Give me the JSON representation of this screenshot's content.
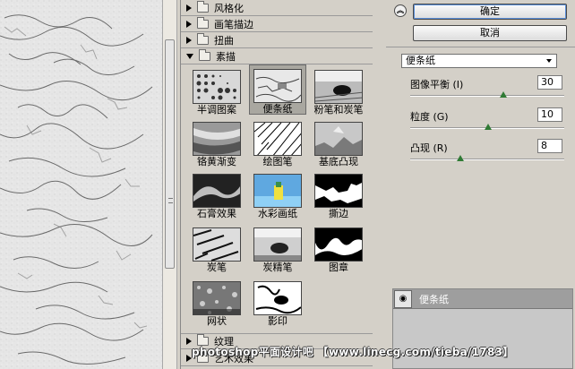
{
  "gallery": {
    "categories_top": [
      {
        "label": "风格化"
      },
      {
        "label": "画笔描边"
      },
      {
        "label": "扭曲"
      }
    ],
    "open_category": {
      "label": "素描"
    },
    "categories_bottom": [
      {
        "label": "纹理"
      },
      {
        "label": "艺术效果"
      }
    ],
    "filters": [
      {
        "label": "半调图案"
      },
      {
        "label": "便条纸"
      },
      {
        "label": "粉笔和炭笔"
      },
      {
        "label": "铬黄渐变"
      },
      {
        "label": "绘图笔"
      },
      {
        "label": "基底凸现"
      },
      {
        "label": "石膏效果"
      },
      {
        "label": "水彩画纸"
      },
      {
        "label": "撕边"
      },
      {
        "label": "炭笔"
      },
      {
        "label": "炭精笔"
      },
      {
        "label": "图章"
      },
      {
        "label": "网状"
      },
      {
        "label": "影印"
      }
    ],
    "selected_filter": "便条纸"
  },
  "controls": {
    "collapse_icon": "double-chevron-up-icon",
    "ok_label": "确定",
    "cancel_label": "取消",
    "filter_select_value": "便条纸",
    "params": [
      {
        "label": "图像平衡 (I)",
        "value": "30",
        "slider_fraction": 0.62
      },
      {
        "label": "粒度 (G)",
        "value": "10",
        "slider_fraction": 0.5
      },
      {
        "label": "凸现 (R)",
        "value": "8",
        "slider_fraction": 0.32
      }
    ]
  },
  "layers": {
    "eye_icon": "eye-icon",
    "layer_name": "便条纸"
  },
  "watermark": "photoshop平面设计吧 【www.linecg.com/tieba/1783】",
  "colors": {
    "slider_knob": "#2f7a34",
    "ok_focus": "#5a8ed8"
  }
}
